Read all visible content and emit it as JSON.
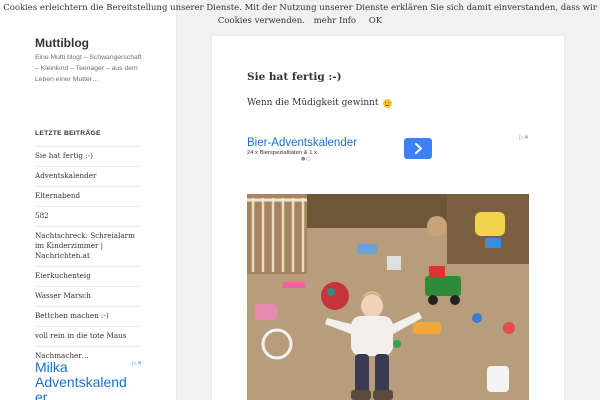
{
  "cookie": {
    "text": "Cookies erleichtern die Bereitstellung unserer Dienste. Mit der Nutzung unserer Dienste erklären Sie sich damit einverstanden, dass wir Cookies verwenden.",
    "more": "mehr Info",
    "ok": "OK"
  },
  "site": {
    "title": "Muttiblog",
    "description": "Eine Mutti blogt – Schwangerschaft – Kleinkind – Teenager – aus dem Leben einer Mutter…"
  },
  "recent": {
    "title": "LETZTE BEITRÄGE",
    "items": [
      "Sie hat fertig :-)",
      "Adventskalender",
      "Elternabend",
      "582",
      "Nachtschreck: Schreialarm im Kinderzimmer | Nachrichten.at",
      "Eierkuchenteig",
      "Wasser Marsch",
      "Bettchen machen :-)",
      "voll rein in die tote Maus",
      "Nachmacher…"
    ]
  },
  "side_ad": {
    "title": "Milka Adventskalend er"
  },
  "post": {
    "title": "Sie hat fertig :-)",
    "text": "Wenn die Müdigkeit gewinnt"
  },
  "ad": {
    "headline": "Bier-Adventskalender",
    "sub": "24 x Bierspezialitäten & 1 x"
  },
  "colors": {
    "ad_blue": "#1a6fcf",
    "button_blue": "#3b82f6"
  }
}
